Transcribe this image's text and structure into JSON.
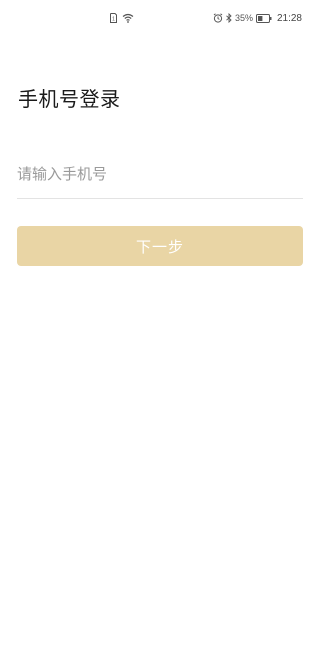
{
  "status_bar": {
    "battery_percent": "35%",
    "time": "21:28",
    "icons": [
      "sim-icon",
      "wifi-icon",
      "alarm-icon",
      "bluetooth-icon",
      "battery-icon"
    ]
  },
  "login": {
    "title": "手机号登录",
    "phone_input": {
      "value": "",
      "placeholder": "请输入手机号"
    },
    "next_label": "下一步"
  },
  "colors": {
    "button_bg": "#e9d5a5",
    "button_text": "#ffffff",
    "title_text": "#1a1a1a",
    "placeholder_text": "#9a9a9a",
    "divider": "#e3e3e3"
  }
}
